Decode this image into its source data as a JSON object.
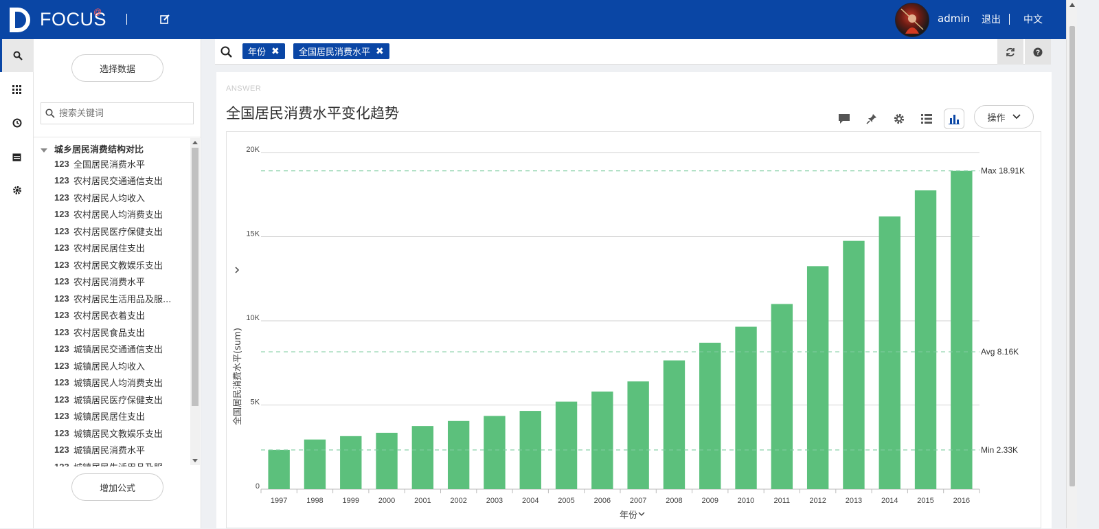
{
  "app": {
    "logo": "FOCUS",
    "logo_superscript": "@"
  },
  "header": {
    "username": "admin",
    "logout": "退出",
    "language": "中文"
  },
  "rail": {
    "items": [
      "search-icon",
      "apps-icon",
      "history-icon",
      "calendar-icon",
      "settings-icon"
    ]
  },
  "side": {
    "select_data": "选择数据",
    "search_placeholder": "搜索关键词",
    "group_title": "城乡居民消费结构对比",
    "items": [
      {
        "type": "123",
        "label": "全国居民消费水平"
      },
      {
        "type": "123",
        "label": "农村居民交通通信支出"
      },
      {
        "type": "123",
        "label": "农村居民人均收入"
      },
      {
        "type": "123",
        "label": "农村居民人均消费支出"
      },
      {
        "type": "123",
        "label": "农村居民医疗保健支出"
      },
      {
        "type": "123",
        "label": "农村居民居住支出"
      },
      {
        "type": "123",
        "label": "农村居民文教娱乐支出"
      },
      {
        "type": "123",
        "label": "农村居民消费水平"
      },
      {
        "type": "123",
        "label": "农村居民生活用品及服..."
      },
      {
        "type": "123",
        "label": "农村居民衣着支出"
      },
      {
        "type": "123",
        "label": "农村居民食品支出"
      },
      {
        "type": "123",
        "label": "城镇居民交通通信支出"
      },
      {
        "type": "123",
        "label": "城镇居民人均收入"
      },
      {
        "type": "123",
        "label": "城镇居民人均消费支出"
      },
      {
        "type": "123",
        "label": "城镇居民医疗保健支出"
      },
      {
        "type": "123",
        "label": "城镇居民居住支出"
      },
      {
        "type": "123",
        "label": "城镇居民文教娱乐支出"
      },
      {
        "type": "123",
        "label": "城镇居民消费水平"
      },
      {
        "type": "123",
        "label": "城镇居民生活用品及服"
      }
    ],
    "add_formula": "增加公式"
  },
  "query": {
    "tokens": [
      "年份",
      "全国居民消费水平"
    ]
  },
  "answer": {
    "label": "ANSWER",
    "title": "全国居民消费水平变化趋势",
    "operate": "操作"
  },
  "colors": {
    "brand": "#0a46a5",
    "bar": "#5cc07c",
    "refline": "#7fcca0"
  },
  "chart_data": {
    "type": "bar",
    "categories": [
      "1997",
      "1998",
      "1999",
      "2000",
      "2001",
      "2002",
      "2003",
      "2004",
      "2005",
      "2006",
      "2007",
      "2008",
      "2009",
      "2010",
      "2011",
      "2012",
      "2013",
      "2014",
      "2015",
      "2016"
    ],
    "values": [
      2330,
      2950,
      3150,
      3350,
      3750,
      4050,
      4350,
      4650,
      5200,
      5800,
      6400,
      7650,
      8700,
      9650,
      11000,
      13250,
      14750,
      16200,
      17750,
      18910
    ],
    "xlabel": "年份",
    "ylabel": "全国居民消费水平(sum)",
    "yticks": [
      "0",
      "5K",
      "10K",
      "15K",
      "20K"
    ],
    "ylim": [
      0,
      20000
    ],
    "grid": true,
    "reference_lines": [
      {
        "label": "Max 18.91K",
        "value": 18910
      },
      {
        "label": "Avg 8.16K",
        "value": 8160
      },
      {
        "label": "Min 2.33K",
        "value": 2330
      }
    ]
  }
}
